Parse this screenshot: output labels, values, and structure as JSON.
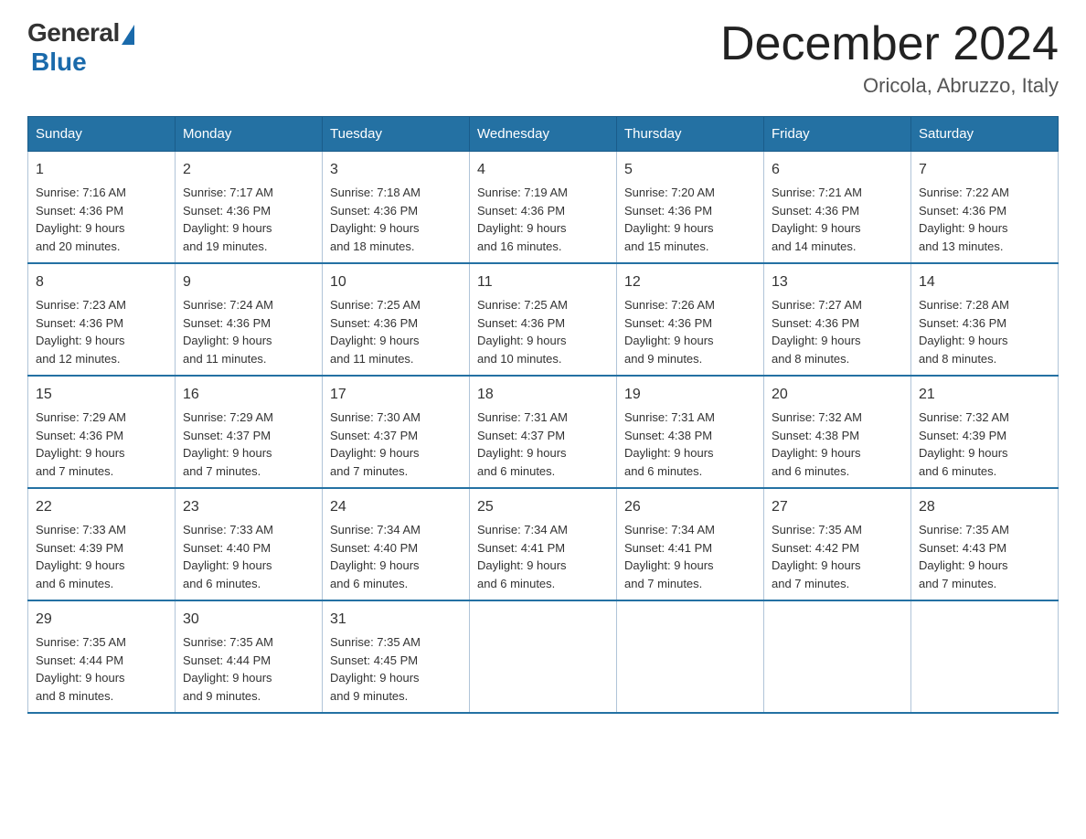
{
  "logo": {
    "general": "General",
    "blue": "Blue"
  },
  "title": "December 2024",
  "location": "Oricola, Abruzzo, Italy",
  "days_header": [
    "Sunday",
    "Monday",
    "Tuesday",
    "Wednesday",
    "Thursday",
    "Friday",
    "Saturday"
  ],
  "weeks": [
    [
      {
        "day": "1",
        "sunrise": "7:16 AM",
        "sunset": "4:36 PM",
        "daylight": "9 hours and 20 minutes."
      },
      {
        "day": "2",
        "sunrise": "7:17 AM",
        "sunset": "4:36 PM",
        "daylight": "9 hours and 19 minutes."
      },
      {
        "day": "3",
        "sunrise": "7:18 AM",
        "sunset": "4:36 PM",
        "daylight": "9 hours and 18 minutes."
      },
      {
        "day": "4",
        "sunrise": "7:19 AM",
        "sunset": "4:36 PM",
        "daylight": "9 hours and 16 minutes."
      },
      {
        "day": "5",
        "sunrise": "7:20 AM",
        "sunset": "4:36 PM",
        "daylight": "9 hours and 15 minutes."
      },
      {
        "day": "6",
        "sunrise": "7:21 AM",
        "sunset": "4:36 PM",
        "daylight": "9 hours and 14 minutes."
      },
      {
        "day": "7",
        "sunrise": "7:22 AM",
        "sunset": "4:36 PM",
        "daylight": "9 hours and 13 minutes."
      }
    ],
    [
      {
        "day": "8",
        "sunrise": "7:23 AM",
        "sunset": "4:36 PM",
        "daylight": "9 hours and 12 minutes."
      },
      {
        "day": "9",
        "sunrise": "7:24 AM",
        "sunset": "4:36 PM",
        "daylight": "9 hours and 11 minutes."
      },
      {
        "day": "10",
        "sunrise": "7:25 AM",
        "sunset": "4:36 PM",
        "daylight": "9 hours and 11 minutes."
      },
      {
        "day": "11",
        "sunrise": "7:25 AM",
        "sunset": "4:36 PM",
        "daylight": "9 hours and 10 minutes."
      },
      {
        "day": "12",
        "sunrise": "7:26 AM",
        "sunset": "4:36 PM",
        "daylight": "9 hours and 9 minutes."
      },
      {
        "day": "13",
        "sunrise": "7:27 AM",
        "sunset": "4:36 PM",
        "daylight": "9 hours and 8 minutes."
      },
      {
        "day": "14",
        "sunrise": "7:28 AM",
        "sunset": "4:36 PM",
        "daylight": "9 hours and 8 minutes."
      }
    ],
    [
      {
        "day": "15",
        "sunrise": "7:29 AM",
        "sunset": "4:36 PM",
        "daylight": "9 hours and 7 minutes."
      },
      {
        "day": "16",
        "sunrise": "7:29 AM",
        "sunset": "4:37 PM",
        "daylight": "9 hours and 7 minutes."
      },
      {
        "day": "17",
        "sunrise": "7:30 AM",
        "sunset": "4:37 PM",
        "daylight": "9 hours and 7 minutes."
      },
      {
        "day": "18",
        "sunrise": "7:31 AM",
        "sunset": "4:37 PM",
        "daylight": "9 hours and 6 minutes."
      },
      {
        "day": "19",
        "sunrise": "7:31 AM",
        "sunset": "4:38 PM",
        "daylight": "9 hours and 6 minutes."
      },
      {
        "day": "20",
        "sunrise": "7:32 AM",
        "sunset": "4:38 PM",
        "daylight": "9 hours and 6 minutes."
      },
      {
        "day": "21",
        "sunrise": "7:32 AM",
        "sunset": "4:39 PM",
        "daylight": "9 hours and 6 minutes."
      }
    ],
    [
      {
        "day": "22",
        "sunrise": "7:33 AM",
        "sunset": "4:39 PM",
        "daylight": "9 hours and 6 minutes."
      },
      {
        "day": "23",
        "sunrise": "7:33 AM",
        "sunset": "4:40 PM",
        "daylight": "9 hours and 6 minutes."
      },
      {
        "day": "24",
        "sunrise": "7:34 AM",
        "sunset": "4:40 PM",
        "daylight": "9 hours and 6 minutes."
      },
      {
        "day": "25",
        "sunrise": "7:34 AM",
        "sunset": "4:41 PM",
        "daylight": "9 hours and 6 minutes."
      },
      {
        "day": "26",
        "sunrise": "7:34 AM",
        "sunset": "4:41 PM",
        "daylight": "9 hours and 7 minutes."
      },
      {
        "day": "27",
        "sunrise": "7:35 AM",
        "sunset": "4:42 PM",
        "daylight": "9 hours and 7 minutes."
      },
      {
        "day": "28",
        "sunrise": "7:35 AM",
        "sunset": "4:43 PM",
        "daylight": "9 hours and 7 minutes."
      }
    ],
    [
      {
        "day": "29",
        "sunrise": "7:35 AM",
        "sunset": "4:44 PM",
        "daylight": "9 hours and 8 minutes."
      },
      {
        "day": "30",
        "sunrise": "7:35 AM",
        "sunset": "4:44 PM",
        "daylight": "9 hours and 9 minutes."
      },
      {
        "day": "31",
        "sunrise": "7:35 AM",
        "sunset": "4:45 PM",
        "daylight": "9 hours and 9 minutes."
      },
      null,
      null,
      null,
      null
    ]
  ],
  "labels": {
    "sunrise": "Sunrise:",
    "sunset": "Sunset:",
    "daylight": "Daylight:"
  }
}
